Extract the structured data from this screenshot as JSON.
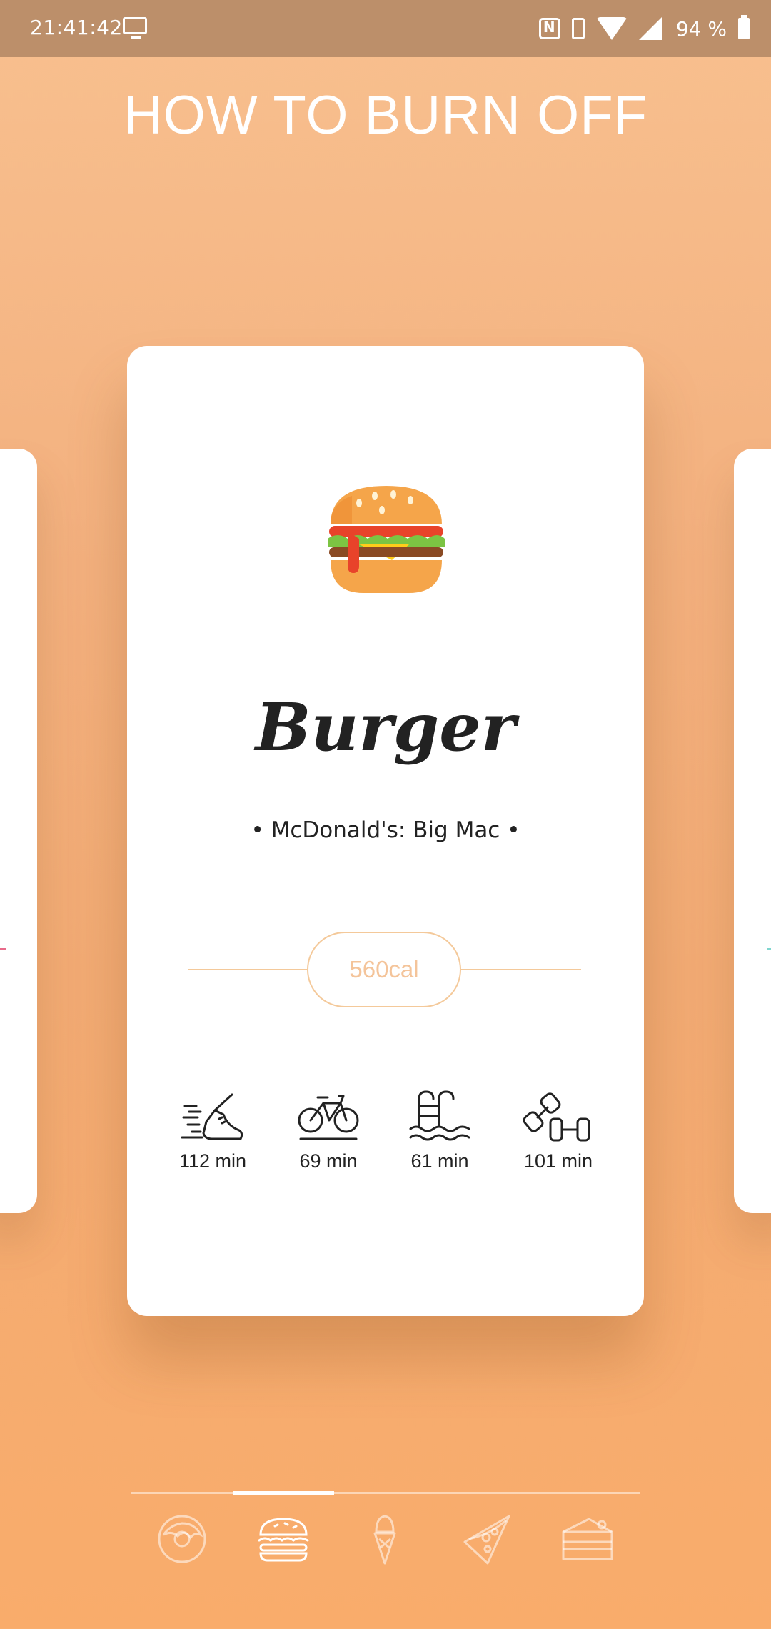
{
  "status": {
    "time": "21:41:42",
    "battery": "94 %"
  },
  "header": {
    "title": "HOW TO BURN OFF"
  },
  "card": {
    "name": "Burger",
    "description": "• McDonald's: Big Mac •",
    "calories": "560cal",
    "activities": [
      {
        "icon": "running-shoe-icon",
        "label": "112 min"
      },
      {
        "icon": "bicycle-icon",
        "label": "69 min"
      },
      {
        "icon": "swimming-pool-icon",
        "label": "61 min"
      },
      {
        "icon": "dumbbell-icon",
        "label": "101 min"
      }
    ]
  },
  "bottom_nav": {
    "items": [
      "donut-icon",
      "burger-icon",
      "ice-cream-icon",
      "pizza-icon",
      "cake-icon"
    ],
    "active_index": 1
  },
  "colors": {
    "accent": "#f4c99a",
    "status_bar": "#bc8f6a",
    "background": "#f3b07e"
  }
}
